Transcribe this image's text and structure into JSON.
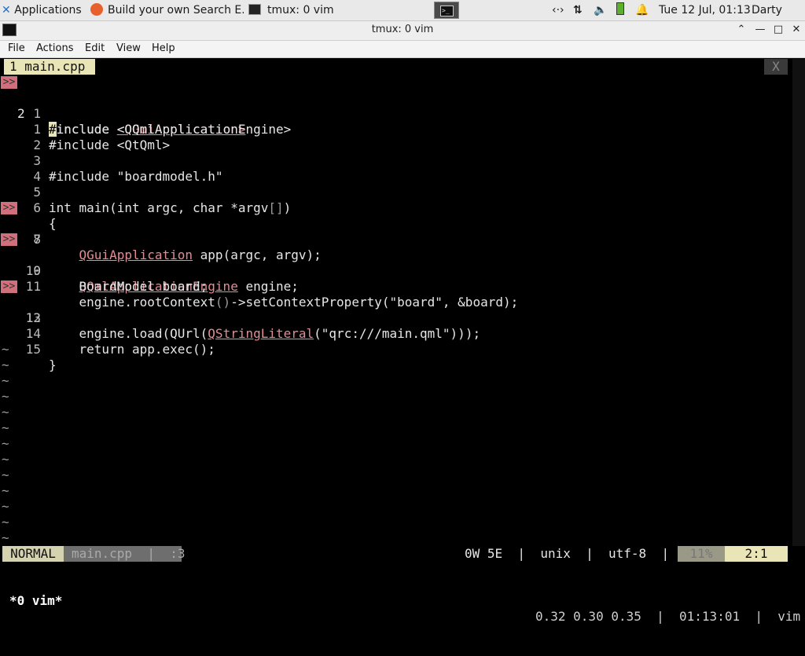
{
  "panel": {
    "applications_label": "Applications",
    "tasks": [
      {
        "title": "Build your own Search E..."
      },
      {
        "title": "tmux: 0 vim"
      }
    ],
    "clock": "Tue 12 Jul, 01:13",
    "user": "Darty uwu",
    "terminal_icon_text": ">_"
  },
  "window": {
    "title": "tmux: 0 vim",
    "minimize": "⌃",
    "min_label": "—",
    "max_label": "□",
    "close_label": "✕"
  },
  "menubar": [
    "File",
    "Actions",
    "Edit",
    "View",
    "Help"
  ],
  "vim": {
    "tab_label": "1 main.cpp",
    "tab_close": "X",
    "sign_text": ">>",
    "lines": [
      {
        "num": "1",
        "sign": true
      },
      {
        "num": "2",
        "sign": false,
        "current": true
      },
      {
        "num": "1",
        "sign": false
      },
      {
        "num": "2",
        "sign": false
      },
      {
        "num": "3",
        "sign": false
      },
      {
        "num": "4",
        "sign": false
      },
      {
        "num": "5",
        "sign": false
      },
      {
        "num": "6",
        "sign": false
      },
      {
        "num": "7",
        "sign": true
      },
      {
        "num": "8",
        "sign": false
      },
      {
        "num": "9",
        "sign": true
      },
      {
        "num": "10",
        "sign": false
      },
      {
        "num": "11",
        "sign": false
      },
      {
        "num": "12",
        "sign": true
      },
      {
        "num": "13",
        "sign": false
      },
      {
        "num": "14",
        "sign": false
      },
      {
        "num": "15",
        "sign": false
      }
    ],
    "code": {
      "l1a": "#include ",
      "l1b": "<QGuiApplication>",
      "l2a": "#",
      "l2b": "include <QQmlApplicationEngine>",
      "l3": "#include <QtQml>",
      "l5": "#include \"boardmodel.h\"",
      "l7a": "int main(int argc, char *argv",
      "l7b": "[]",
      "l7c": ")",
      "l8": "{",
      "l9a": "    ",
      "l9b": "QGuiApplication",
      "l9c": " app(argc, argv);",
      "l11a": "    ",
      "l11b": "QQmlApplicationEngine",
      "l11c": " engine;",
      "l12": "    BoardModel board;",
      "l13a": "    engine.rootContext",
      "l13b": "()",
      "l13c": "->setContextProperty(\"board\", &board);",
      "l14a": "    engine.load(QUrl(",
      "l14b": "QStringLiteral",
      "l14c": "(\"qrc:///main.qml\"",
      "l14d": ")));",
      "l16": "    return app.exec();",
      "l17": "}"
    },
    "tilde": "~",
    "status": {
      "mode": "NORMAL",
      "file": "main.cpp  |  :3",
      "right": "0W 5E  |  unix  |  utf-8  |  cpp",
      "percent": "11%",
      "position": "2:1"
    }
  },
  "tmux": {
    "window": "*0 vim*",
    "right": "0.32 0.30 0.35  |  01:13:01  |  vim"
  }
}
